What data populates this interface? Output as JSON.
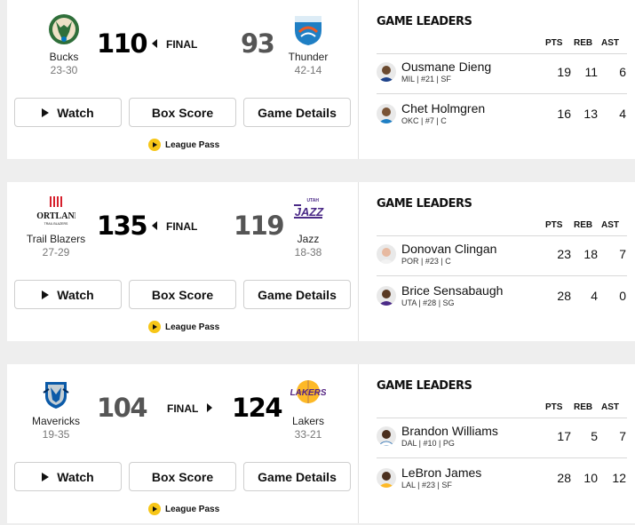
{
  "games": [
    {
      "away": {
        "name": "Bucks",
        "record": "23-30",
        "score": "110",
        "logo": "bucks-logo"
      },
      "home": {
        "name": "Thunder",
        "record": "42-14",
        "score": "93",
        "logo": "thunder-logo"
      },
      "status": "FINAL",
      "winner": "away",
      "buttons": {
        "watch": "Watch",
        "box_score": "Box Score",
        "game_details": "Game Details"
      },
      "league_pass": "League Pass",
      "leaders_title": "GAME LEADERS",
      "stat_headers": [
        "PTS",
        "REB",
        "AST"
      ],
      "leaders": [
        {
          "name": "Ousmane Dieng",
          "info": "MIL | #21 | SF",
          "pts": "19",
          "reb": "11",
          "ast": "6"
        },
        {
          "name": "Chet Holmgren",
          "info": "OKC | #7 | C",
          "pts": "16",
          "reb": "13",
          "ast": "4"
        }
      ]
    },
    {
      "away": {
        "name": "Trail Blazers",
        "record": "27-29",
        "score": "135",
        "logo": "trail-blazers-logo",
        "logo_text": "PORTLAND",
        "logo_subtext": "TRAIL BLAZERS"
      },
      "home": {
        "name": "Jazz",
        "record": "18-38",
        "score": "119",
        "logo": "jazz-logo",
        "logo_text": "JAZZ",
        "logo_subtext": "UTAH"
      },
      "status": "FINAL",
      "winner": "away",
      "buttons": {
        "watch": "Watch",
        "box_score": "Box Score",
        "game_details": "Game Details"
      },
      "league_pass": "League Pass",
      "leaders_title": "GAME LEADERS",
      "stat_headers": [
        "PTS",
        "REB",
        "AST"
      ],
      "leaders": [
        {
          "name": "Donovan Clingan",
          "info": "POR | #23 | C",
          "pts": "23",
          "reb": "18",
          "ast": "7"
        },
        {
          "name": "Brice Sensabaugh",
          "info": "UTA | #28 | SG",
          "pts": "28",
          "reb": "4",
          "ast": "0"
        }
      ]
    },
    {
      "away": {
        "name": "Mavericks",
        "record": "19-35",
        "score": "104",
        "logo": "mavericks-logo"
      },
      "home": {
        "name": "Lakers",
        "record": "33-21",
        "score": "124",
        "logo": "lakers-logo",
        "logo_text": "LAKERS"
      },
      "status": "FINAL",
      "winner": "home",
      "buttons": {
        "watch": "Watch",
        "box_score": "Box Score",
        "game_details": "Game Details"
      },
      "league_pass": "League Pass",
      "leaders_title": "GAME LEADERS",
      "stat_headers": [
        "PTS",
        "REB",
        "AST"
      ],
      "leaders": [
        {
          "name": "Brandon Williams",
          "info": "DAL | #10 | PG",
          "pts": "17",
          "reb": "5",
          "ast": "7"
        },
        {
          "name": "LeBron James",
          "info": "LAL | #23 | SF",
          "pts": "28",
          "reb": "10",
          "ast": "12"
        }
      ]
    }
  ],
  "colors": {
    "league_pass_yellow": "#f7c617",
    "bucks_green": "#2f6f3a",
    "thunder_blue": "#1f7fc4",
    "thunder_orange": "#ef5a23",
    "blazers_red": "#d6202c",
    "jazz_purple": "#4b2a87",
    "mavs_blue": "#0b5aa8",
    "lakers_purple": "#552583",
    "lakers_gold": "#fdb927"
  }
}
